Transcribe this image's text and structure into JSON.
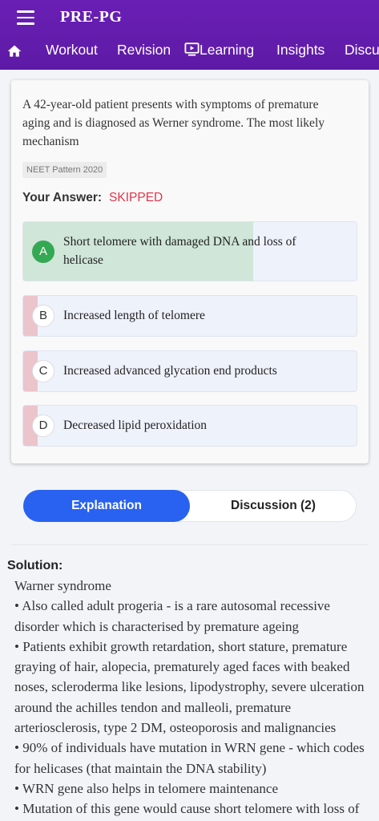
{
  "header": {
    "title": "PRE-PG",
    "nav": [
      "Workout",
      "Revision",
      "Learning",
      "Insights",
      "Discu"
    ]
  },
  "question": {
    "text": "A 42-year-old patient presents with symptoms of premature aging and is diagnosed as Werner syndrome. The most likely mechanism",
    "tag": "NEET Pattern 2020",
    "answer_label": "Your Answer:",
    "answer_value": "SKIPPED",
    "options": [
      {
        "letter": "A",
        "text": "Short telomere with damaged DNA and loss of helicase",
        "percent": 69,
        "correct": true
      },
      {
        "letter": "B",
        "text": "Increased length of telomere",
        "percent": 4
      },
      {
        "letter": "C",
        "text": "Increased advanced glycation end products",
        "percent": 7
      },
      {
        "letter": "D",
        "text": "Decreased lipid peroxidation",
        "percent": 4
      }
    ]
  },
  "tabs": {
    "explanation": "Explanation",
    "discussion": "Discussion (2)"
  },
  "solution": {
    "title": "Solution:",
    "lines": [
      "Warner syndrome",
      "• Also called adult progeria - is a rare autosomal recessive disorder which is characterised by premature ageing",
      "• Patients exhibit growth retardation, short stature, premature graying of hair, alopecia, prematurely aged faces with beaked noses, scleroderma like lesions, lipodystrophy, severe ulceration around the achilles tendon and malleoli, premature arteriosclerosis, type 2 DM, osteoporosis and malignancies",
      "• 90% of individuals have mutation in WRN gene - which codes for helicases (that maintain the DNA stability)",
      "• WRN gene also helps in telomere maintenance",
      "• Mutation of this gene would cause short telomere with loss of"
    ]
  },
  "colors": {
    "header": "#5d1aa6",
    "correct": "#34a853",
    "skipped": "#e0374a",
    "tab_active": "#2962f0"
  }
}
